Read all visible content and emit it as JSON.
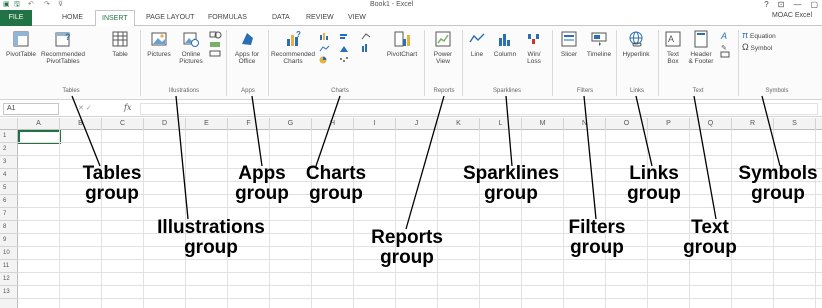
{
  "window": {
    "title": "Book1 - Excel",
    "controls": [
      "?",
      "⊡",
      "—",
      "▢"
    ],
    "account": "MOAC Excel"
  },
  "tabs": {
    "file": "FILE",
    "items": [
      "HOME",
      "INSERT",
      "PAGE LAYOUT",
      "FORMULAS",
      "DATA",
      "REVIEW",
      "VIEW"
    ]
  },
  "ribbon": {
    "tables": {
      "pivottable": "PivotTable",
      "recommended_pivottables_1": "Recommended",
      "recommended_pivottables_2": "PivotTables",
      "table": "Table",
      "label": "Tables"
    },
    "illustrations": {
      "pictures": "Pictures",
      "online_pictures_1": "Online",
      "online_pictures_2": "Pictures",
      "label": "Illustrations"
    },
    "apps": {
      "apps_for_office_1": "Apps for",
      "apps_for_office_2": "Office",
      "label": "Apps"
    },
    "charts": {
      "recommended_charts_1": "Recommended",
      "recommended_charts_2": "Charts",
      "pivotchart": "PivotChart",
      "label": "Charts"
    },
    "reports": {
      "power_view_1": "Power",
      "power_view_2": "View",
      "label": "Reports"
    },
    "sparklines": {
      "line": "Line",
      "column": "Column",
      "winloss_1": "Win/",
      "winloss_2": "Loss",
      "label": "Sparklines"
    },
    "filters": {
      "slicer": "Slicer",
      "timeline": "Timeline",
      "label": "Filters"
    },
    "links": {
      "hyperlink": "Hyperlink",
      "label": "Links"
    },
    "text": {
      "textbox_1": "Text",
      "textbox_2": "Box",
      "header_footer_1": "Header",
      "header_footer_2": "& Footer",
      "label": "Text"
    },
    "symbols": {
      "equation": "Equation",
      "symbol": "Symbol",
      "label": "Symbols"
    }
  },
  "formula_bar": {
    "name_box": "A1",
    "fx": "fx"
  },
  "grid": {
    "columns": [
      "A",
      "B",
      "C",
      "D",
      "E",
      "F",
      "G",
      "H",
      "I",
      "J",
      "K",
      "L",
      "M",
      "N",
      "O",
      "P",
      "Q",
      "R",
      "S"
    ],
    "rows": [
      "1",
      "2",
      "3",
      "4",
      "5",
      "6",
      "7",
      "8",
      "9",
      "10",
      "11",
      "12",
      "13"
    ]
  },
  "callouts": {
    "tables_1": "Tables",
    "tables_2": "group",
    "illustrations_1": "Illustrations",
    "illustrations_2": "group",
    "apps_1": "Apps",
    "apps_2": "group",
    "charts_1": "Charts",
    "charts_2": "group",
    "reports_1": "Reports",
    "reports_2": "group",
    "sparklines_1": "Sparklines",
    "sparklines_2": "group",
    "filters_1": "Filters",
    "filters_2": "group",
    "links_1": "Links",
    "links_2": "group",
    "text_1": "Text",
    "text_2": "group",
    "symbols_1": "Symbols",
    "symbols_2": "group"
  },
  "colors": {
    "excel_green": "#217346",
    "ribbon_bg": "#fbfbfb",
    "grid_line": "#e1e1e1"
  }
}
